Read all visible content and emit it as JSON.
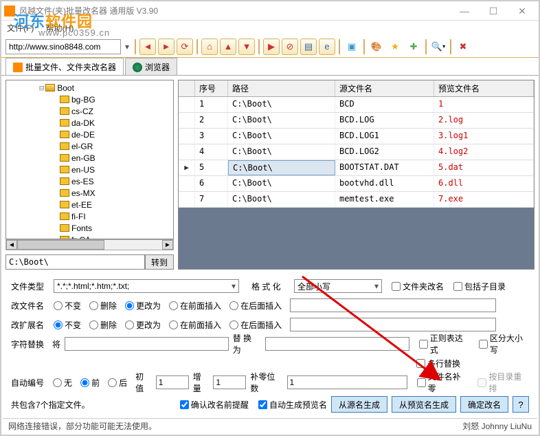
{
  "title": "风越文件(夹)批量改名器 通用版 V3.90",
  "watermark": {
    "text1": "河东",
    "text2": "软件园",
    "domain": "www.pc0359.cn"
  },
  "menu": {
    "file": "文件(F)",
    "help": "帮助(H)"
  },
  "url": "http://www.sino8848.com",
  "tabs": {
    "rename": "批量文件、文件夹改名器",
    "browser": "浏览器"
  },
  "tree": {
    "root": "Boot",
    "items": [
      "bg-BG",
      "cs-CZ",
      "da-DK",
      "de-DE",
      "el-GR",
      "en-GB",
      "en-US",
      "es-ES",
      "es-MX",
      "et-EE",
      "fi-FI",
      "Fonts",
      "fr-CA"
    ]
  },
  "path": "C:\\Boot\\",
  "go_btn": "转到",
  "grid": {
    "headers": {
      "seq": "序号",
      "path": "路径",
      "src": "源文件名",
      "preview": "预览文件名"
    },
    "rows": [
      {
        "seq": "1",
        "path": "C:\\Boot\\",
        "src": "BCD",
        "preview": "1"
      },
      {
        "seq": "2",
        "path": "C:\\Boot\\",
        "src": "BCD.LOG",
        "preview": "2.log"
      },
      {
        "seq": "3",
        "path": "C:\\Boot\\",
        "src": "BCD.LOG1",
        "preview": "3.log1"
      },
      {
        "seq": "4",
        "path": "C:\\Boot\\",
        "src": "BCD.LOG2",
        "preview": "4.log2"
      },
      {
        "seq": "5",
        "path": "C:\\Boot\\",
        "src": "BOOTSTAT.DAT",
        "preview": "5.dat",
        "sel": true
      },
      {
        "seq": "6",
        "path": "C:\\Boot\\",
        "src": "bootvhd.dll",
        "preview": "6.dll"
      },
      {
        "seq": "7",
        "path": "C:\\Boot\\",
        "src": "memtest.exe",
        "preview": "7.exe"
      }
    ]
  },
  "opts": {
    "filetype_lbl": "文件类型",
    "filetype_val": "*.*;*.html;*.htm;*.txt;",
    "format_lbl": "格 式 化",
    "format_val": "全部小写",
    "rename_folder": "文件夹改名",
    "include_sub": "包括子目录",
    "change_name_lbl": "改文件名",
    "change_ext_lbl": "改扩展名",
    "r_none": "不变",
    "r_del": "删除",
    "r_change": "更改为",
    "r_pre": "在前面插入",
    "r_post": "在后面插入",
    "char_replace_lbl": "字符替换",
    "char_from_lbl": "将",
    "char_to_lbl": "替 换 为",
    "regex": "正则表达式",
    "casesens": "区分大小写",
    "multiline": "多行替换",
    "autonum_lbl": "自动编号",
    "r_off": "无",
    "r_front": "前",
    "r_back": "后",
    "init_lbl": "初值",
    "init_val": "1",
    "step_lbl": "增量",
    "step_val": "1",
    "pad_lbl": "补零位数",
    "pad_val": "1",
    "pad_name": "文件名补零",
    "by_dir": "按目录重排",
    "count_text": "共包含7个指定文件。",
    "confirm_before": "确认改名前提醒",
    "auto_preview": "自动生成预览名",
    "btn_from_src": "从源名生成",
    "btn_from_preview": "从预览名生成",
    "btn_confirm": "确定改名",
    "btn_help": "?"
  },
  "status": {
    "left": "网络连接错误，部分功能可能无法使用。",
    "right": "刘怒 Johnny LiuNu"
  }
}
